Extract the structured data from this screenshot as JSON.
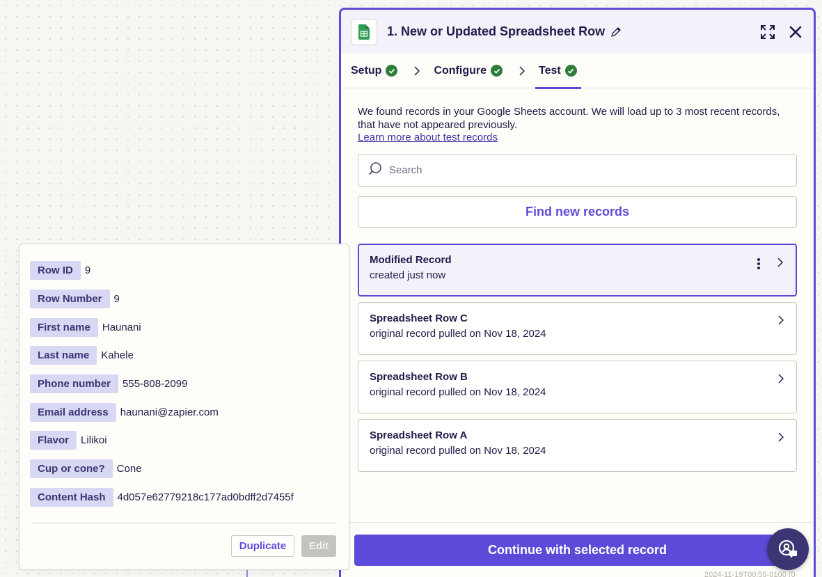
{
  "panel": {
    "step_title": "1. New or Updated Spreadsheet Row",
    "tabs": [
      {
        "label": "Setup",
        "done": true
      },
      {
        "label": "Configure",
        "done": true
      },
      {
        "label": "Test",
        "done": true,
        "active": true
      }
    ],
    "description": "We found records in your Google Sheets account. We will load up to 3 most recent records, that have not appeared previously.",
    "learn_link": "Learn more about test records",
    "search_placeholder": "Search",
    "find_button": "Find new records",
    "records": [
      {
        "title": "Modified Record",
        "subtitle": "created just now",
        "selected": true
      },
      {
        "title": "Spreadsheet Row C",
        "subtitle": "original record pulled on Nov 18, 2024"
      },
      {
        "title": "Spreadsheet Row B",
        "subtitle": "original record pulled on Nov 18, 2024"
      },
      {
        "title": "Spreadsheet Row A",
        "subtitle": "original record pulled on Nov 18, 2024"
      }
    ],
    "continue_button": "Continue with selected record"
  },
  "record_detail": {
    "fields": [
      {
        "key": "Row ID",
        "value": "9"
      },
      {
        "key": "Row Number",
        "value": "9"
      },
      {
        "key": "First name",
        "value": "Haunani"
      },
      {
        "key": "Last name",
        "value": "Kahele"
      },
      {
        "key": "Phone number",
        "value": "555-808-2099"
      },
      {
        "key": "Email address",
        "value": "haunani@zapier.com"
      },
      {
        "key": "Flavor",
        "value": "Lilikoi"
      },
      {
        "key": "Cup or cone?",
        "value": "Cone"
      },
      {
        "key": "Content Hash",
        "value": "4d057e62779218c177ad0bdff2d7455f"
      }
    ],
    "duplicate_button": "Duplicate",
    "edit_button": "Edit"
  },
  "footer_timestamp": "2024-11-19T00:55-0100 (0",
  "icons": {
    "app": "google-sheets-icon",
    "edit_title": "pencil-icon",
    "expand": "expand-icon",
    "close": "close-icon",
    "search": "search-icon",
    "more": "more-vertical-icon",
    "chevron": "chevron-right-icon",
    "help": "help-chat-icon"
  },
  "colors": {
    "accent": "#5c4bd8",
    "success": "#2e7d3a",
    "key_badge": "#d8d7f4",
    "canvas": "#f7f6f2"
  }
}
